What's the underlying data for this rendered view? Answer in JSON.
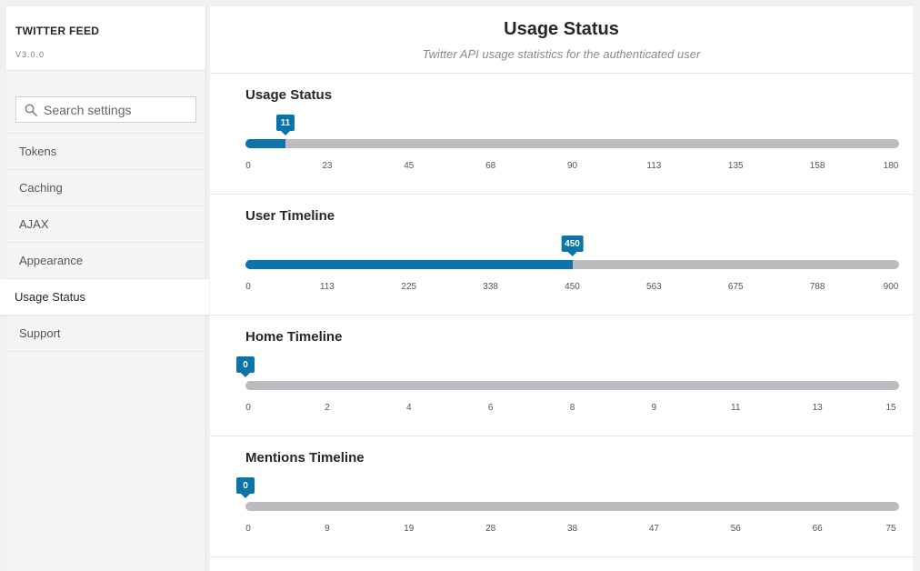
{
  "sidebar": {
    "brand_title": "TWITTER FEED",
    "version": "V3.0.0",
    "search_placeholder": "Search settings",
    "items": [
      {
        "label": "Tokens",
        "active": false
      },
      {
        "label": "Caching",
        "active": false
      },
      {
        "label": "AJAX",
        "active": false
      },
      {
        "label": "Appearance",
        "active": false
      },
      {
        "label": "Usage Status",
        "active": true
      },
      {
        "label": "Support",
        "active": false
      }
    ]
  },
  "main": {
    "title": "Usage Status",
    "subtitle": "Twitter API usage statistics for the authenticated user",
    "sections": [
      {
        "title": "Usage Status",
        "value": 11,
        "max": 180,
        "bubble": "11",
        "ticks": [
          "0",
          "23",
          "45",
          "68",
          "90",
          "113",
          "135",
          "158",
          "180"
        ]
      },
      {
        "title": "User Timeline",
        "value": 450,
        "max": 900,
        "bubble": "450",
        "ticks": [
          "0",
          "113",
          "225",
          "338",
          "450",
          "563",
          "675",
          "788",
          "900"
        ]
      },
      {
        "title": "Home Timeline",
        "value": 0,
        "max": 15,
        "bubble": "0",
        "ticks": [
          "0",
          "2",
          "4",
          "6",
          "8",
          "9",
          "11",
          "13",
          "15"
        ]
      },
      {
        "title": "Mentions Timeline",
        "value": 0,
        "max": 75,
        "bubble": "0",
        "ticks": [
          "0",
          "9",
          "19",
          "28",
          "38",
          "47",
          "56",
          "66",
          "75"
        ]
      }
    ]
  },
  "colors": {
    "accent": "#0c74aa",
    "track": "#bbbcbf"
  },
  "icons": {
    "search": "search-icon"
  }
}
